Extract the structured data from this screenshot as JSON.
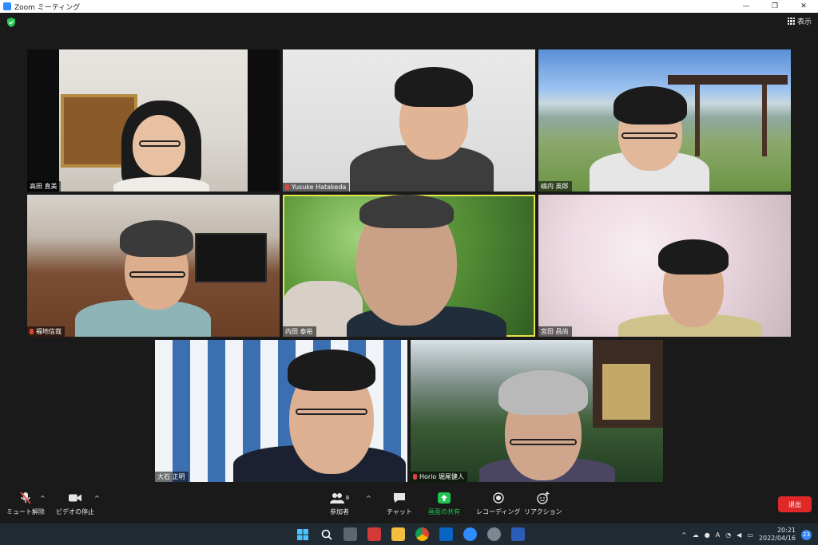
{
  "window": {
    "title": "Zoom ミーティング",
    "minimize": "—",
    "restore": "❐",
    "close": "✕"
  },
  "header": {
    "view_label": "表示"
  },
  "participants": [
    {
      "name": "高田 直美",
      "muted": false
    },
    {
      "name": "Yusuke Hatakeda",
      "muted": true
    },
    {
      "name": "嶋内 英郎",
      "muted": false
    },
    {
      "name": "福地信哉",
      "muted": true
    },
    {
      "name": "内田 泰裕",
      "muted": false
    },
    {
      "name": "宮田 昌尚",
      "muted": false
    },
    {
      "name": "大石 正明",
      "muted": false
    },
    {
      "name": "Horio 堀尾健人",
      "muted": true
    }
  ],
  "toolbar": {
    "mute_label": "ミュート解除",
    "video_label": "ビデオの停止",
    "participants_label": "参加者",
    "participants_count": "8",
    "chat_label": "チャット",
    "share_label": "画面の共有",
    "record_label": "レコーディング",
    "reactions_label": "リアクション",
    "leave_label": "退出",
    "share_color": "#23c552",
    "leave_color": "#e02828"
  },
  "taskbar": {
    "time": "20:21",
    "date": "2022/04/16",
    "notifications": "23",
    "ime": "A"
  }
}
